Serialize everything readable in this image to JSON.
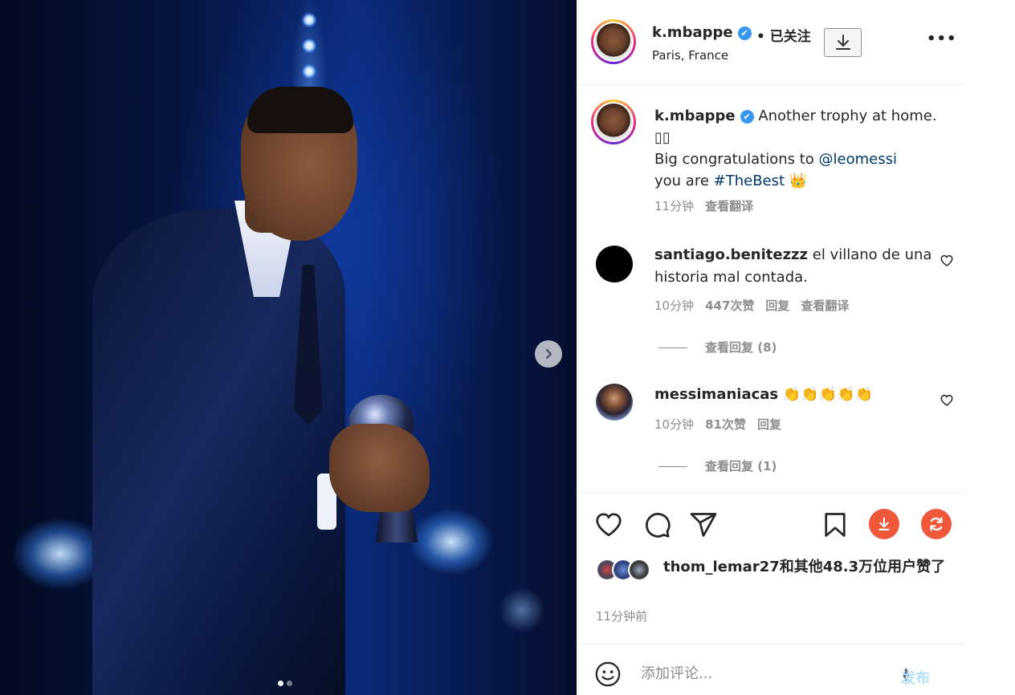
{
  "post": {
    "username": "k.mbappe",
    "verified_glyph": "✔",
    "follow_status": "• 已关注",
    "location": "Paris, France",
    "more_glyph": "•••"
  },
  "caption": {
    "username": "k.mbappe",
    "line1": "Another trophy at home. ",
    "box_glyphs": "▯▯",
    "line2_prefix": "Big congratulations to ",
    "mention": "@leomessi",
    "line3_prefix": "you are ",
    "hashtag": "#TheBest",
    "crown_emoji": "👑",
    "time": "11分钟",
    "translate": "查看翻译"
  },
  "comments": [
    {
      "username": "santiago.benitezzz",
      "text": "el villano de una historia mal contada.",
      "time": "10分钟",
      "likes": "447次赞",
      "reply": "回复",
      "translate": "查看翻译",
      "view_replies": "查看回复 (8)"
    },
    {
      "username": "messimaniacas",
      "text": "👏👏👏👏👏",
      "time": "10分钟",
      "likes": "81次赞",
      "reply": "回复",
      "view_replies": "查看回复 (1)"
    }
  ],
  "likes": {
    "text": "thom_lemar27和其他48.3万位用户赞了"
  },
  "posted_time": "11分钟前",
  "comment_box": {
    "placeholder": "添加评论...",
    "publish_label": "发布"
  },
  "carousel": {
    "slide_count": 2,
    "active_index": 0
  },
  "colors": {
    "link": "#00376b",
    "verified": "#3897f0",
    "download_orange": "#f0583a",
    "publish_disabled": "#b2dffc"
  },
  "icons": [
    "chevron-right-icon",
    "download-icon",
    "more-icon",
    "heart-icon",
    "comment-icon",
    "share-icon",
    "bookmark-icon",
    "download-circle-icon",
    "refresh-circle-icon",
    "emoji-icon"
  ]
}
